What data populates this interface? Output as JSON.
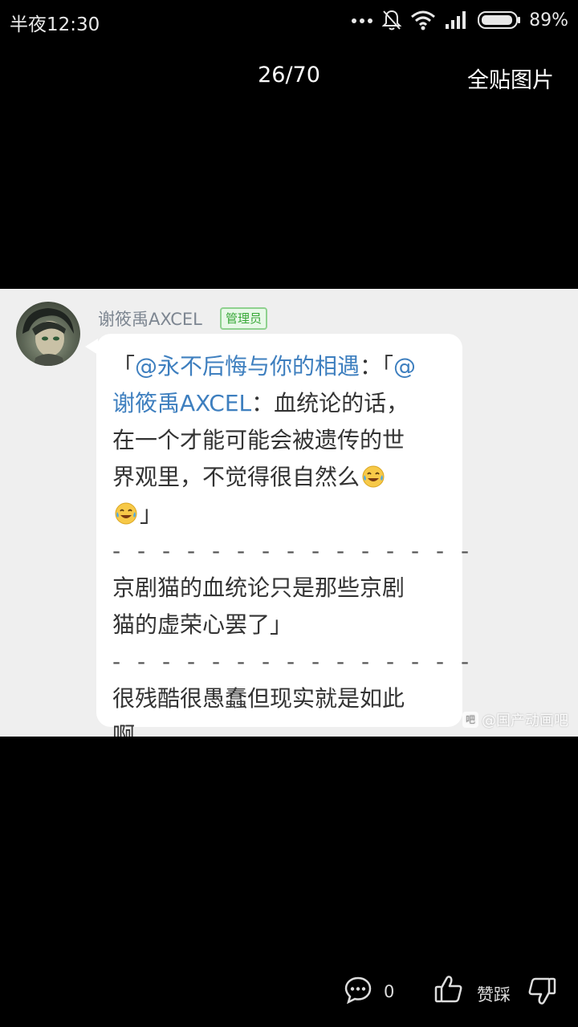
{
  "status_bar": {
    "time": "半夜12:30",
    "battery": "89%",
    "icons": [
      "more-dots-icon",
      "mute-bell-icon",
      "wifi-icon",
      "signal-icon",
      "battery-icon"
    ]
  },
  "viewer": {
    "counter": "26/70",
    "all_images": "全贴图片"
  },
  "post": {
    "username": "谢筱禹AXCEL",
    "badge": "管理员",
    "lines": [
      {
        "segments": [
          {
            "t": "「",
            "c": "text"
          },
          {
            "t": "@永不后悔与你的相遇",
            "c": "mention"
          },
          {
            "t": "：「",
            "c": "text"
          },
          {
            "t": "@",
            "c": "mention"
          }
        ]
      },
      {
        "segments": [
          {
            "t": "谢筱禹AXCEL",
            "c": "mention"
          },
          {
            "t": "：血统论的话，",
            "c": "text"
          }
        ]
      },
      {
        "segments": [
          {
            "t": "在一个才能可能会被遗传的世",
            "c": "text"
          }
        ]
      },
      {
        "segments": [
          {
            "t": "界观里，不觉得很自然么",
            "c": "text"
          },
          {
            "t": "laughing-tears-emoji",
            "c": "emoji"
          }
        ]
      },
      {
        "segments": [
          {
            "t": "laughing-tears-emoji",
            "c": "emoji"
          },
          {
            "t": "」",
            "c": "text"
          }
        ]
      },
      {
        "segments": [
          {
            "t": "- - - - - - - - - - - - - - -",
            "c": "dashes"
          }
        ]
      },
      {
        "segments": [
          {
            "t": "京剧猫的血统论只是那些京剧",
            "c": "text"
          }
        ]
      },
      {
        "segments": [
          {
            "t": "猫的虚荣心罢了」",
            "c": "text"
          }
        ]
      },
      {
        "segments": [
          {
            "t": "- - - - - - - - - - - - - - -",
            "c": "dashes"
          }
        ]
      },
      {
        "segments": [
          {
            "t": "很残酷很愚蠢但现实就是如此",
            "c": "text"
          }
        ]
      },
      {
        "segments": [
          {
            "t": "啊",
            "c": "text"
          }
        ]
      }
    ],
    "watermark": "@国产动画吧",
    "watermark_logo": "吧"
  },
  "actions": {
    "comment_count": "0",
    "like_label": "赞踩"
  },
  "colors": {
    "mention": "#3e7fbf",
    "badge_green": "#38a838",
    "image_bg": "#efefef"
  }
}
